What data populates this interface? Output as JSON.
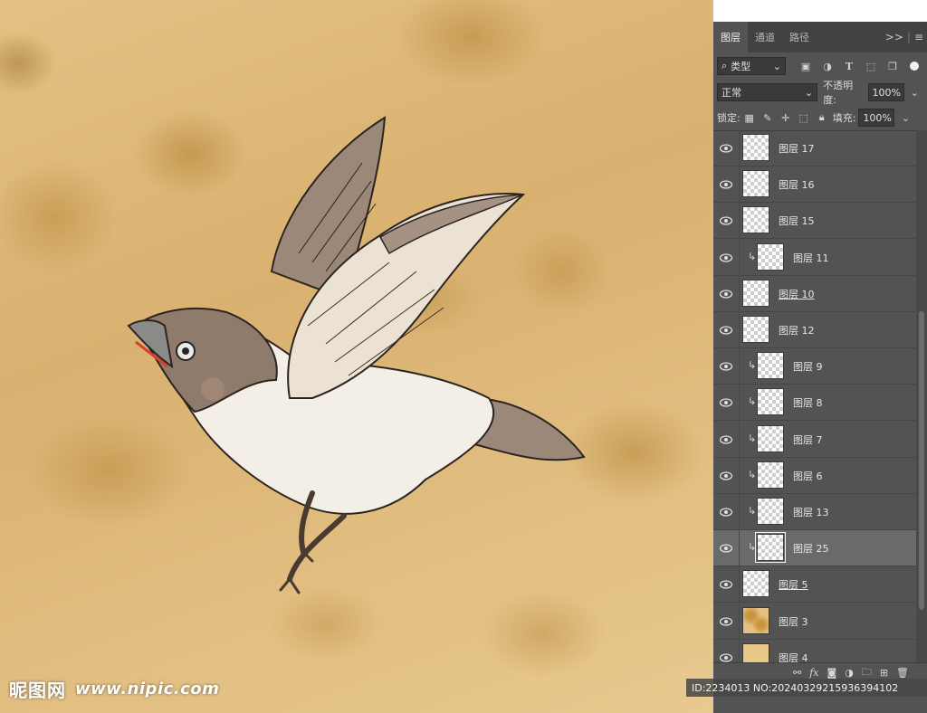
{
  "panel": {
    "tabs": [
      {
        "label": "图层",
        "active": true
      },
      {
        "label": "通道",
        "active": false
      },
      {
        "label": "路径",
        "active": false
      }
    ],
    "menu_glyphs": {
      "collapse": ">>",
      "menu": "≡"
    },
    "filter": {
      "label": "类型",
      "icons": [
        "image-filter-icon",
        "adjustment-filter-icon",
        "type-filter-icon",
        "shape-filter-icon",
        "smart-object-filter-icon",
        "filter-toggle-icon"
      ]
    },
    "blend_mode": "正常",
    "opacity_label": "不透明度:",
    "opacity_value": "100%",
    "lock_label": "锁定:",
    "fill_label": "填充:",
    "fill_value": "100%",
    "layers": [
      {
        "name": "图层 17",
        "clipped": false,
        "linked": false,
        "selected": false,
        "thumb": "transparent"
      },
      {
        "name": "图层 16",
        "clipped": false,
        "linked": false,
        "selected": false,
        "thumb": "transparent"
      },
      {
        "name": "图层 15",
        "clipped": false,
        "linked": false,
        "selected": false,
        "thumb": "transparent"
      },
      {
        "name": "图层 11",
        "clipped": true,
        "linked": false,
        "selected": false,
        "thumb": "transparent"
      },
      {
        "name": "图层 10",
        "clipped": false,
        "linked": true,
        "selected": false,
        "thumb": "transparent"
      },
      {
        "name": "图层 12",
        "clipped": false,
        "linked": false,
        "selected": false,
        "thumb": "transparent"
      },
      {
        "name": "图层 9",
        "clipped": true,
        "linked": false,
        "selected": false,
        "thumb": "transparent"
      },
      {
        "name": "图层 8",
        "clipped": true,
        "linked": false,
        "selected": false,
        "thumb": "transparent"
      },
      {
        "name": "图层 7",
        "clipped": true,
        "linked": false,
        "selected": false,
        "thumb": "transparent"
      },
      {
        "name": "图层 6",
        "clipped": true,
        "linked": false,
        "selected": false,
        "thumb": "transparent"
      },
      {
        "name": "图层 13",
        "clipped": true,
        "linked": false,
        "selected": false,
        "thumb": "transparent"
      },
      {
        "name": "图层 25",
        "clipped": true,
        "linked": false,
        "selected": true,
        "thumb": "transparent"
      },
      {
        "name": "图层 5",
        "clipped": false,
        "linked": true,
        "selected": false,
        "thumb": "transparent"
      },
      {
        "name": "图层 3",
        "clipped": false,
        "linked": false,
        "selected": false,
        "thumb": "texture"
      },
      {
        "name": "图层 4",
        "clipped": false,
        "linked": false,
        "selected": false,
        "thumb": "solid"
      }
    ],
    "bottom_icons": [
      "link-layers-icon",
      "fx-icon",
      "add-mask-icon",
      "adjustment-layer-icon",
      "new-group-icon",
      "new-layer-icon",
      "delete-layer-icon"
    ]
  },
  "watermark": {
    "logo": "昵图网",
    "url": "www.nipic.com"
  },
  "image_id": "ID:2234013 NO:20240329215936394102",
  "colors": {
    "panel_bg": "#535353",
    "tab_bar": "#424242",
    "selected_row": "#6a6a6a",
    "canvas_base": "#e3c183"
  }
}
